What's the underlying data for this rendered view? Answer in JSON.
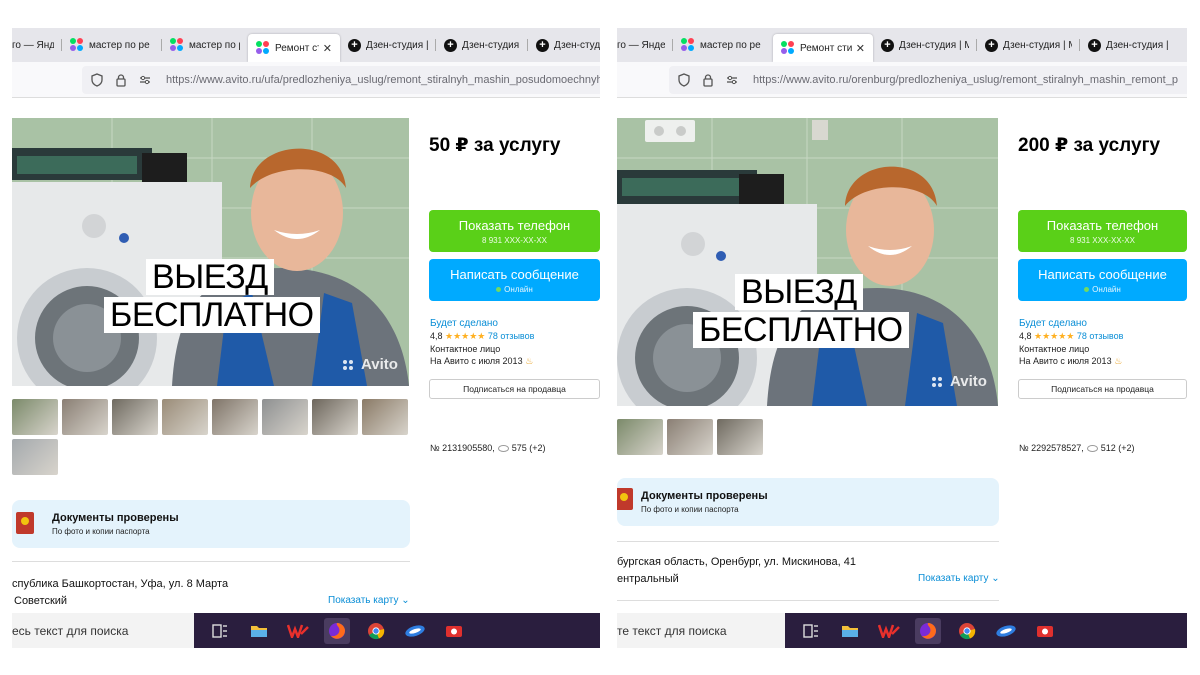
{
  "panels": [
    {
      "tabs": [
        {
          "label": "го — Яндек",
          "icon": "none"
        },
        {
          "label": "мастер по ре",
          "icon": "yandex-services-icon"
        },
        {
          "label": "мастер по ре",
          "icon": "yandex-services-icon"
        },
        {
          "label": "Ремонт сти",
          "icon": "yandex-services-icon",
          "active": true
        },
        {
          "label": "Дзен-студия |",
          "icon": "zen-icon"
        },
        {
          "label": "Дзен-студия",
          "icon": "zen-icon"
        },
        {
          "label": "Дзен-студи",
          "icon": "zen-icon"
        }
      ],
      "url": "https://www.avito.ru/ufa/predlozheniya_uslug/remont_stiralnyh_mashin_posudomoechnyh_",
      "overlay_line1": "ВЫЕЗД",
      "overlay_line2": "БЕСПЛАТНО",
      "watermark": "Avito",
      "price": "50 ₽ за услугу",
      "show_phone": "Показать телефон",
      "phone_masked": "8 931 XXX-XX-XX",
      "write_message": "Написать сообщение",
      "online": "Онлайн",
      "seller_name": "Будет сделано",
      "rating": "4,8",
      "stars": "★★★★★",
      "reviews": "78 отзывов",
      "contact": "Контактное лицо",
      "since": "На Авито с июля 2013",
      "subscribe": "Подписаться на продавца",
      "ad_number": "№ 2131905580,",
      "views": "575 (+2)",
      "thumb_count": 9,
      "docs_title": "Документы проверены",
      "docs_sub": "По фото и копии паспорта",
      "address_line1": "спублика Башкортостан, Уфа, ул. 8 Марта",
      "address_line2": "Советский",
      "show_map": "Показать карту",
      "search_text": "есь текст для поиска"
    },
    {
      "tabs": [
        {
          "label": "го — Яндекс",
          "icon": "none"
        },
        {
          "label": "мастер по ре",
          "icon": "yandex-services-icon"
        },
        {
          "label": "Ремонт стир",
          "icon": "yandex-services-icon",
          "active": true
        },
        {
          "label": "Дзен-студия | М",
          "icon": "zen-icon"
        },
        {
          "label": "Дзен-студия | М",
          "icon": "zen-icon"
        },
        {
          "label": "Дзен-студия | М",
          "icon": "zen-icon"
        }
      ],
      "url": "https://www.avito.ru/orenburg/predlozheniya_uslug/remont_stiralnyh_mashin_remont_p",
      "overlay_line1": "ВЫЕЗД",
      "overlay_line2": "БЕСПЛАТНО",
      "watermark": "Avito",
      "price": "200 ₽ за услугу",
      "show_phone": "Показать телефон",
      "phone_masked": "8 931 XXX-XX-XX",
      "write_message": "Написать сообщение",
      "online": "Онлайн",
      "seller_name": "Будет сделано",
      "rating": "4,8",
      "stars": "★★★★★",
      "reviews": "78 отзывов",
      "contact": "Контактное лицо",
      "since": "На Авито с июля 2013",
      "subscribe": "Подписаться на продавца",
      "ad_number": "№ 2292578527,",
      "views": "512 (+2)",
      "thumb_count": 3,
      "docs_title": "Документы проверены",
      "docs_sub": "По фото и копии паспорта",
      "address_line1": "бургская область, Оренбург, ул. Мискинова, 41",
      "address_line2": "ентральный",
      "show_map": "Показать карту",
      "search_text": "те текст для поиска"
    }
  ],
  "colors": {
    "green_button": "#5ad018",
    "blue_button": "#00aaff",
    "link": "#0a8ed6",
    "taskbar": "#2a1e3e",
    "docs_background": "#e4f3fc"
  },
  "taskbar_icons": [
    "task-view-icon",
    "file-explorer-icon",
    "wps-office-icon",
    "firefox-icon",
    "chrome-icon",
    "app-icon",
    "screen-recorder-icon"
  ]
}
